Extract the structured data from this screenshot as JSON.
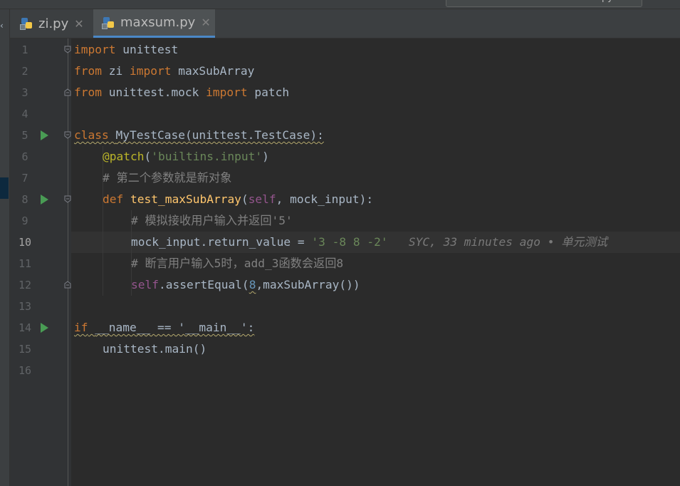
{
  "tabs": [
    {
      "label": "zi.py",
      "active": false
    },
    {
      "label": "maxsum.py",
      "active": true
    }
  ],
  "topbar": {
    "search_suffix": "py"
  },
  "icons": {
    "python_file": "python-file-icon",
    "close": "close-icon",
    "run": "run-gutter-icon",
    "fold": "fold-marker-icon",
    "intention": "lightbulb-icon"
  },
  "colors": {
    "keyword": "#cc7832",
    "function": "#ffc66d",
    "string": "#6a8759",
    "comment": "#808080",
    "self": "#94558d",
    "number": "#6897bb",
    "decorator": "#bbb529",
    "tab_underline": "#4a88c7",
    "run": "#499c54"
  },
  "editor": {
    "current_line": 10,
    "line_numbers": [
      "1",
      "2",
      "3",
      "4",
      "5",
      "6",
      "7",
      "8",
      "9",
      "10",
      "11",
      "12",
      "13",
      "14",
      "15",
      "16"
    ],
    "code": {
      "l1_import": "import",
      "l1_mod": " unittest",
      "l2_from": "from",
      "l2_zi": " zi ",
      "l2_import": "import",
      "l2_name": " maxSubArray",
      "l3_from": "from",
      "l3_mod": " unittest.mock ",
      "l3_import": "import",
      "l3_name": " patch",
      "l5_class": "class",
      "l5_decl": "MyTestCase(unittest.TestCase):",
      "l6_deco": "@patch",
      "l6_open": "(",
      "l6_str": "'builtins.input'",
      "l6_close": ")",
      "l7_comment": "# 第二个参数就是新对象",
      "l8_def": "def",
      "l8_fn": "test_maxSubArray",
      "l8_open": "(",
      "l8_self": "self",
      "l8_rest": ", mock_input):",
      "l9_comment": "# 模拟接收用户输入并返回'5'",
      "l10_left": "mock_input.return_value = ",
      "l10_str": "'3 -8 8 -2'",
      "l11_comment": "# 断言用户输入5时，add_3函数会返回8",
      "l12_self": "self",
      "l12_mid": ".assertEqual(",
      "l12_num": "8",
      "l12_rest": ",maxSubArray())",
      "l14_if": "if",
      "l14_cond": "__name__ == '__main__':",
      "l15_call": "unittest.main()"
    },
    "blame": "SYC, 33 minutes ago • 单元测试"
  }
}
